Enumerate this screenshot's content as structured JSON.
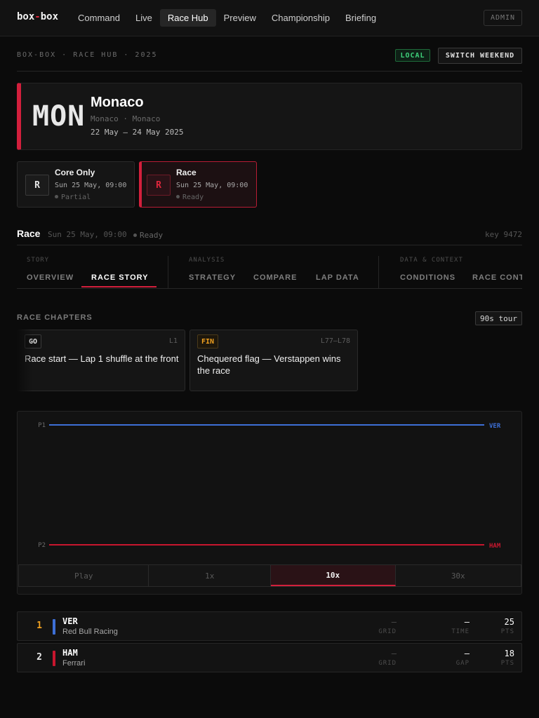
{
  "nav": {
    "brand_left": "box",
    "brand_dash": "-",
    "brand_right": "box",
    "links": [
      {
        "label": "Command"
      },
      {
        "label": "Live"
      },
      {
        "label": "Race Hub"
      },
      {
        "label": "Preview"
      },
      {
        "label": "Championship"
      },
      {
        "label": "Briefing"
      }
    ],
    "active_index": 2,
    "admin_label": "ADMIN"
  },
  "header": {
    "breadcrumb": "BOX-BOX · RACE HUB · 2025",
    "local_badge": "LOCAL",
    "switch_label": "SWITCH WEEKEND"
  },
  "event": {
    "code": "MON",
    "name": "Monaco",
    "location": "Monaco · Monaco",
    "dates": "22 May – 24 May 2025",
    "accent_color": "#d21f3c"
  },
  "sessions": [
    {
      "icon_letter": "R",
      "title": "Core Only",
      "time": "Sun 25 May, 09:00",
      "status": "Partial"
    },
    {
      "icon_letter": "R",
      "title": "Race",
      "time": "Sun 25 May, 09:00",
      "status": "Ready"
    }
  ],
  "race_header": {
    "title": "Race",
    "time": "Sun 25 May, 09:00",
    "status": "Ready",
    "key": "key 9472"
  },
  "tabs": {
    "groups": [
      {
        "label": "STORY",
        "tabs": [
          "OVERVIEW",
          "RACE STORY"
        ]
      },
      {
        "label": "ANALYSIS",
        "tabs": [
          "STRATEGY",
          "COMPARE",
          "LAP DATA"
        ]
      },
      {
        "label": "DATA & CONTEXT",
        "tabs": [
          "CONDITIONS",
          "RACE CONT"
        ]
      }
    ],
    "active": "RACE STORY"
  },
  "chapters": {
    "title": "RACE CHAPTERS",
    "tour_label": "90s tour",
    "items": [
      {
        "badge": "GO",
        "laps": "L1",
        "text": "Race start — Lap 1 shuffle at the front"
      },
      {
        "badge": "FIN",
        "laps": "L77–L78",
        "text": "Chequered flag — Verstappen wins the race"
      }
    ]
  },
  "chart_data": {
    "type": "line",
    "y_categories": [
      "P1",
      "P2"
    ],
    "series": [
      {
        "name": "VER",
        "position": 1,
        "color": "#3d6fd6"
      },
      {
        "name": "HAM",
        "position": 2,
        "color": "#c8162e"
      }
    ]
  },
  "playback": {
    "speeds": [
      "Play",
      "1x",
      "10x",
      "30x"
    ],
    "active": "10x"
  },
  "standings": [
    {
      "pos": "1",
      "driver": "VER",
      "team": "Red Bull Racing",
      "team_color": "#3d6fd6",
      "grid": "–",
      "grid_label": "GRID",
      "time": "—",
      "time_label": "TIME",
      "pts": "25",
      "pts_label": "PTS"
    },
    {
      "pos": "2",
      "driver": "HAM",
      "team": "Ferrari",
      "team_color": "#c8162e",
      "grid": "–",
      "grid_label": "GRID",
      "time": "—",
      "time_label": "GAP",
      "pts": "18",
      "pts_label": "PTS"
    }
  ]
}
